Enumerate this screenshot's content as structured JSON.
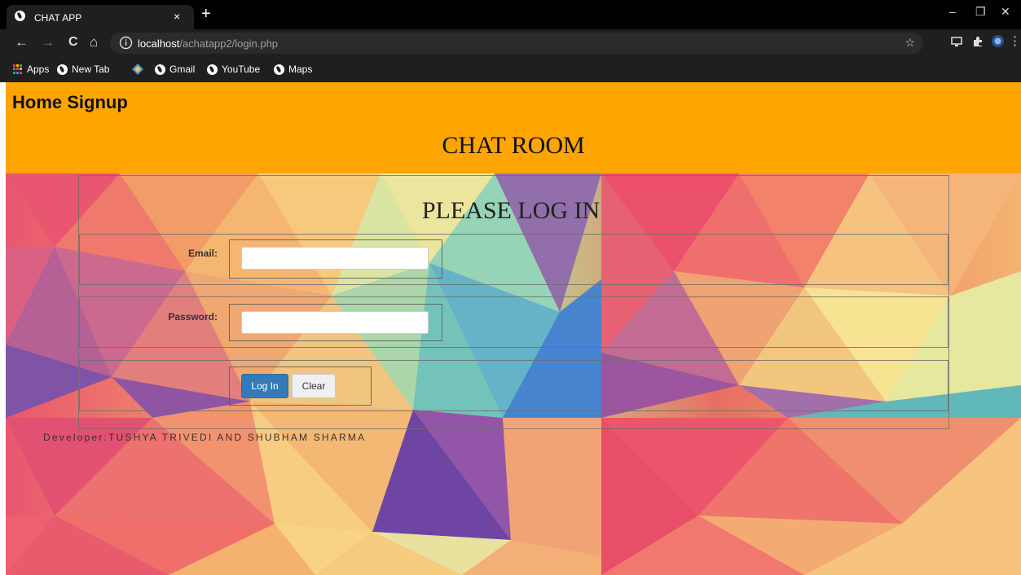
{
  "browser": {
    "tab_title": "CHAT APP",
    "tab_close": "×",
    "new_tab": "+",
    "window_controls": {
      "minimize": "–",
      "restore": "❐",
      "close": "✕"
    },
    "nav": {
      "back": "←",
      "forward": "→",
      "reload": "C",
      "home": "⌂"
    },
    "url_host": "localhost",
    "url_path": "/achatapp2/login.php",
    "bookmarks": [
      "Apps",
      "New Tab",
      "Gmail",
      "YouTube",
      "Maps"
    ],
    "icons": [
      "info-icon",
      "star-icon",
      "cast-icon",
      "extensions-icon",
      "profile-icon",
      "menu-icon",
      "globe-icon",
      "apps-grid-icon",
      "diamond-icon"
    ]
  },
  "page": {
    "nav_text": "Home Signup",
    "heading": "CHAT ROOM",
    "header_color": "#ffa500",
    "form": {
      "title": "PLEASE LOG IN",
      "email_label": "Email:",
      "email_value": "",
      "password_label": "Password:",
      "password_value": "",
      "login_button": "Log In",
      "clear_button": "Clear"
    },
    "footer": "Developer:TUSHYA TRIVEDI AND SHUBHAM SHARMA"
  }
}
